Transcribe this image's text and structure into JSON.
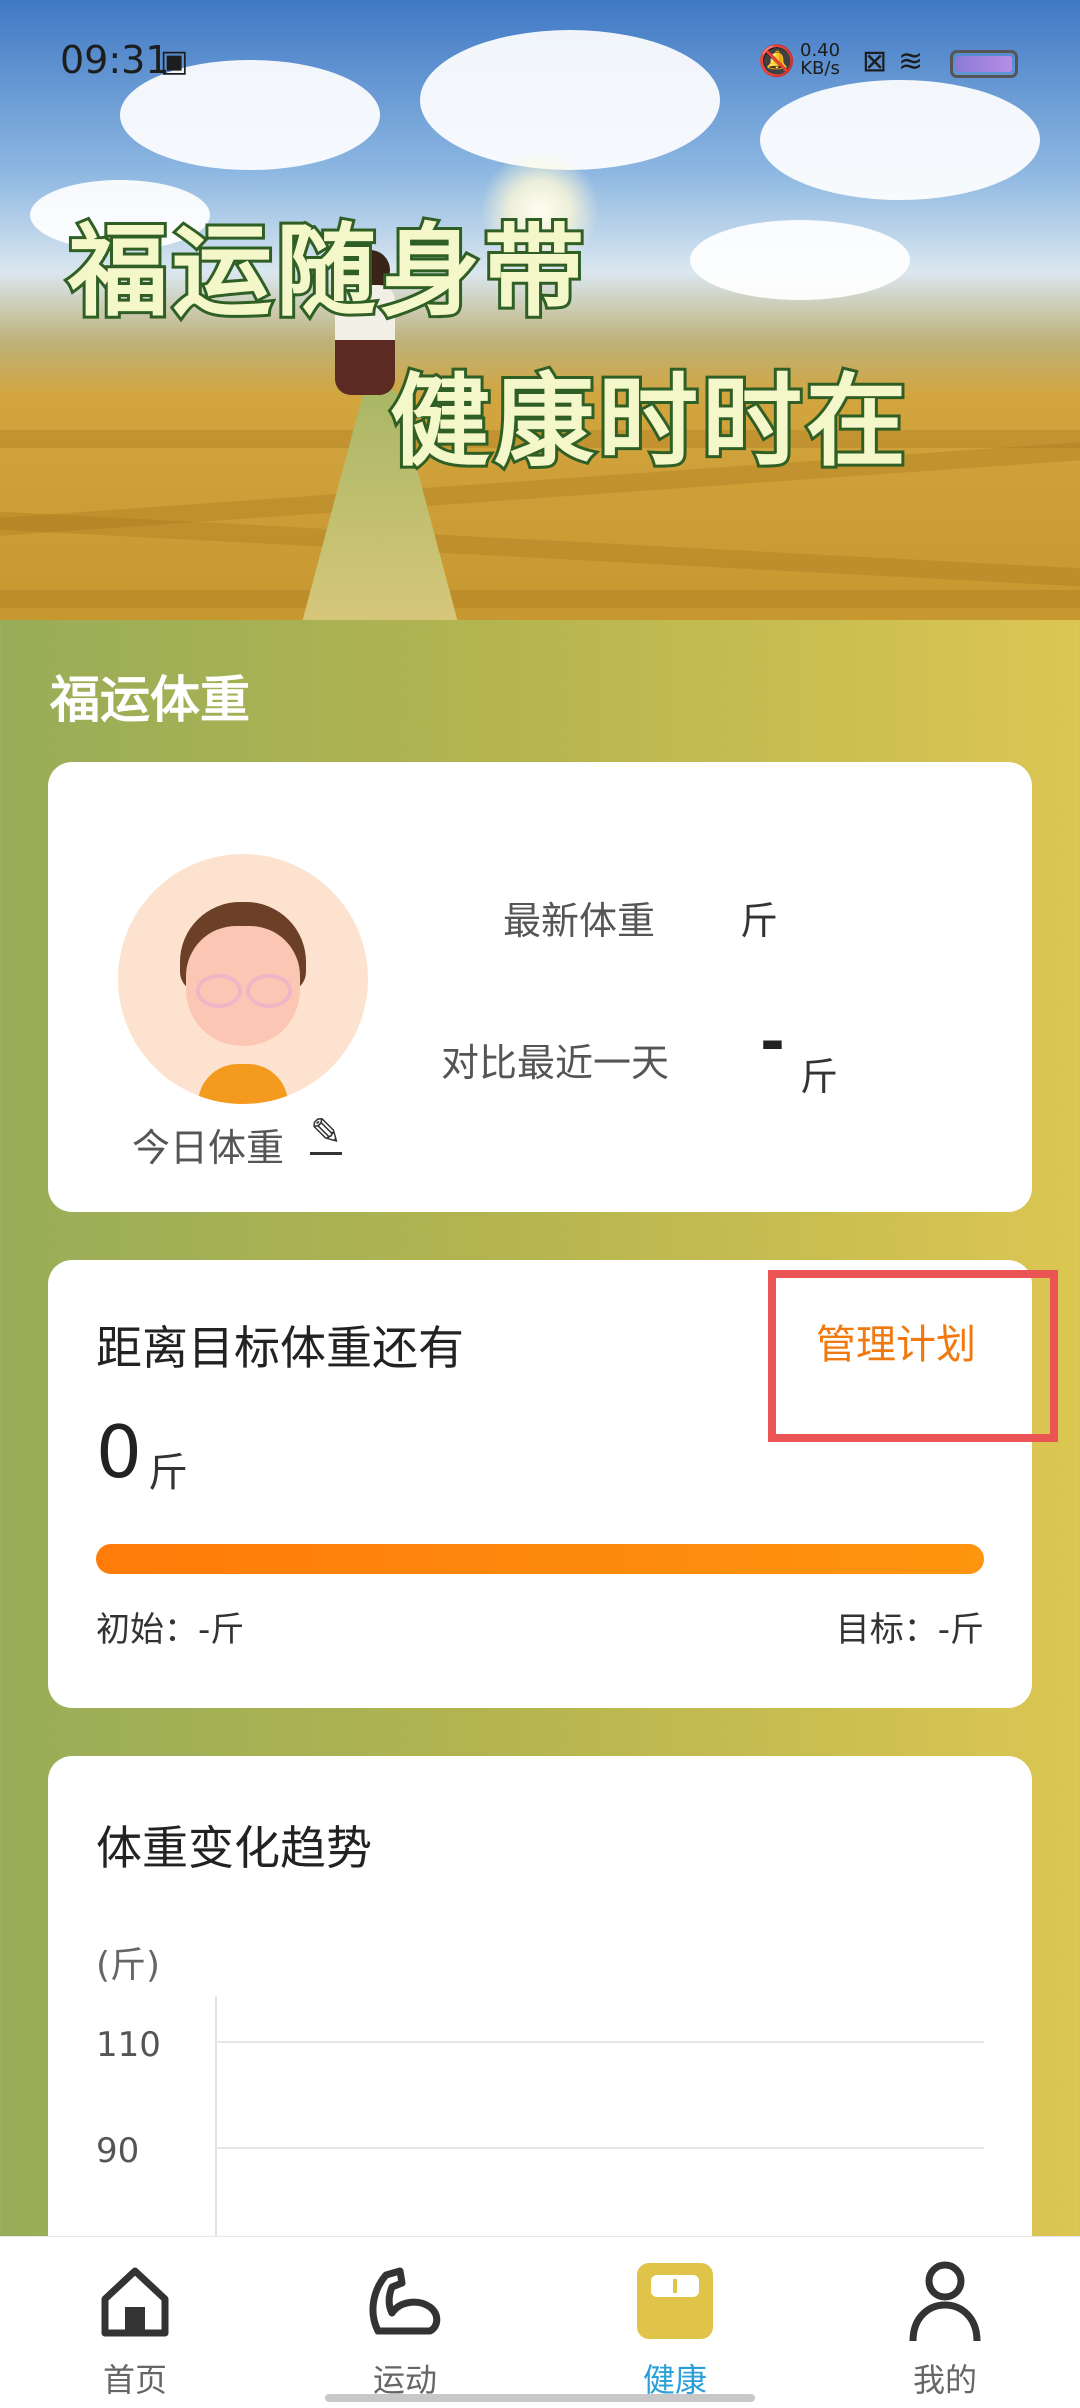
{
  "status_bar": {
    "time": "09:31",
    "net_speed_value": "0.40",
    "net_speed_unit": "KB/s"
  },
  "banner": {
    "line1": "福运随身带",
    "line2": "健康时时在"
  },
  "section_title": "福运体重",
  "weight_card": {
    "today_label": "今日体重",
    "latest_label": "最新体重",
    "latest_unit": "斤",
    "compare_label": "对比最近一天",
    "compare_value": "-",
    "compare_unit": "斤"
  },
  "goal_card": {
    "title": "距离目标体重还有",
    "manage_label": "管理计划",
    "remaining_value": "0",
    "remaining_unit": "斤",
    "progress": 1.0,
    "initial_text": "初始：-斤",
    "target_text": "目标：-斤"
  },
  "trend_card": {
    "title": "体重变化趋势",
    "y_unit": "(斤)",
    "chart_data": {
      "type": "line",
      "ylabel": "(斤)",
      "y_ticks": [
        "110",
        "90"
      ],
      "series": []
    }
  },
  "bottom_nav": {
    "items": [
      {
        "label": "首页",
        "icon": "home-icon"
      },
      {
        "label": "运动",
        "icon": "arm-muscle-icon"
      },
      {
        "label": "健康",
        "icon": "scale-icon"
      },
      {
        "label": "我的",
        "icon": "person-icon"
      }
    ],
    "active": "健康"
  },
  "colors": {
    "accent": "#f07a10",
    "active_nav": "#2a9fd8",
    "highlight_box": "#ea5454",
    "progress_start": "#ff7b0a",
    "progress_end": "#fe950e"
  }
}
